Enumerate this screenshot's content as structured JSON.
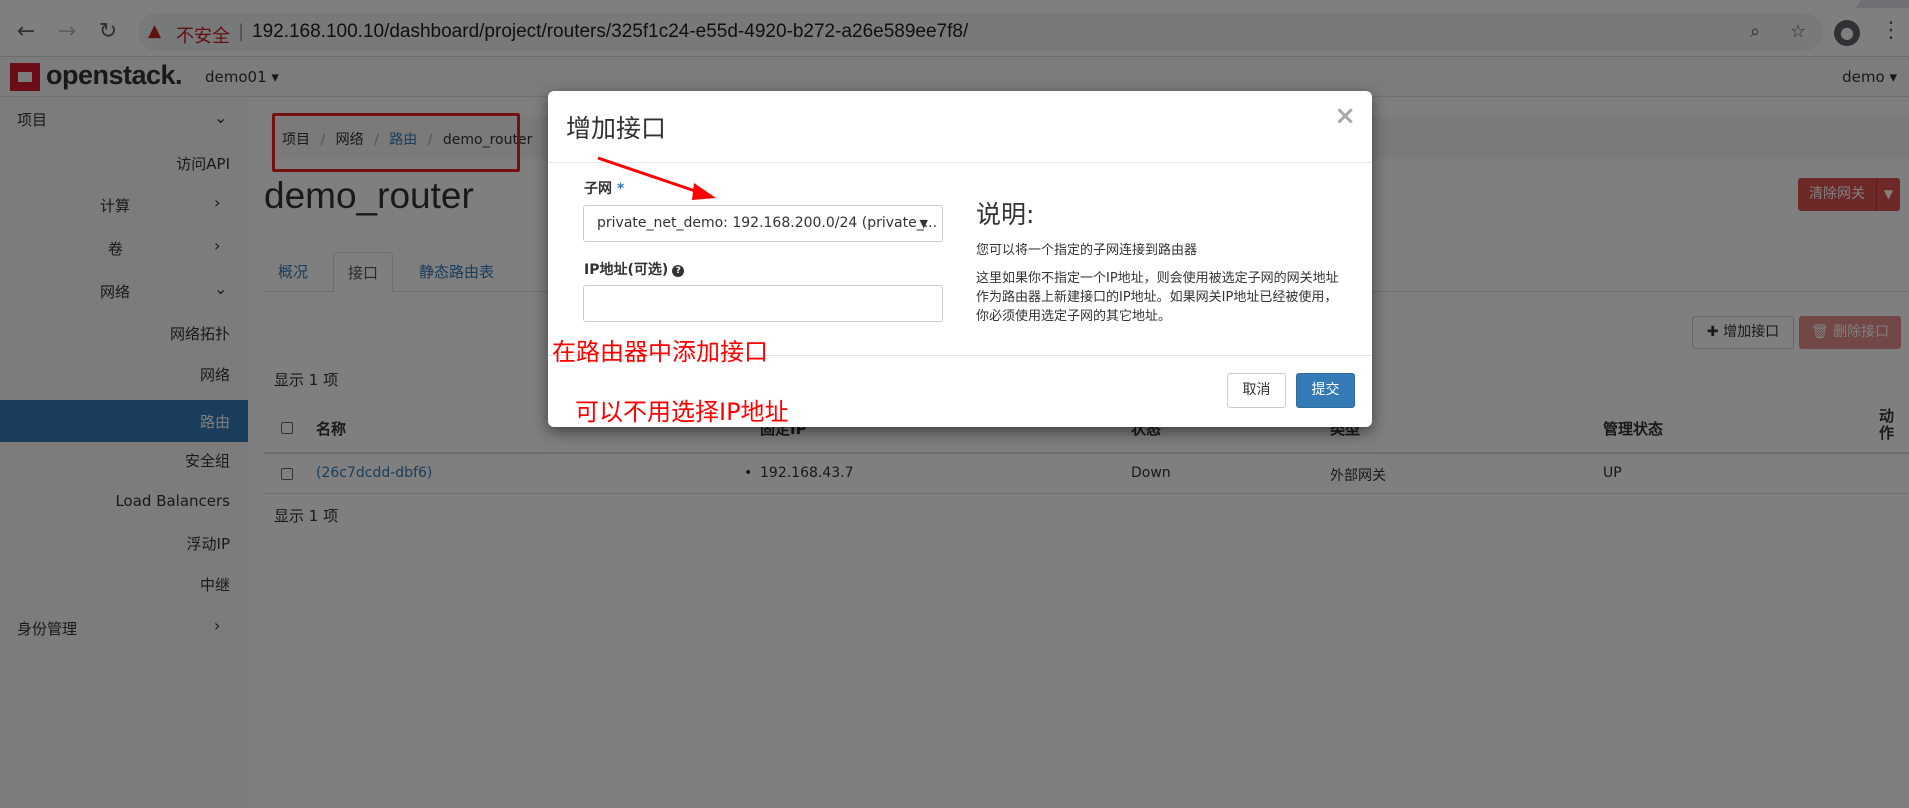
{
  "browser": {
    "insecure_label": "不安全",
    "separator": "|",
    "url": "192.168.100.10/dashboard/project/routers/325f1c24-e55d-4920-b272-a26e589ee7f8/"
  },
  "topnav": {
    "logo_text": "openstack.",
    "project": "demo01 ▾",
    "user": "demo ▾"
  },
  "sidebar": {
    "project": "项目",
    "access_api": "访问API",
    "compute": "计算",
    "volume": "卷",
    "network": "网络",
    "network_topology": "网络拓扑",
    "networks": "网络",
    "routers": "路由",
    "security_groups": "安全组",
    "load_balancers": "Load Balancers",
    "floating_ip": "浮动IP",
    "trunk": "中继",
    "identity": "身份管理"
  },
  "breadcrumb": {
    "project": "项目",
    "network": "网络",
    "routers": "路由",
    "current": "demo_router",
    "sep": "/"
  },
  "page": {
    "title": "demo_router",
    "clear_gateway": "清除网关",
    "tabs": [
      "概况",
      "接口",
      "静态路由表"
    ],
    "add_interface": "✚ 增加接口",
    "delete_interface": "🗑 删除接口",
    "count_label": "显示 1 项"
  },
  "table": {
    "headers": [
      "名称",
      "固定IP",
      "状态",
      "类型",
      "管理状态",
      "动作"
    ],
    "rows": [
      {
        "name": "(26c7dcdd-dbf6)",
        "fixed_ip": "192.168.43.7",
        "status": "Down",
        "type": "外部网关",
        "admin_state": "UP"
      }
    ]
  },
  "modal": {
    "title": "增加接口",
    "close": "×",
    "subnet_label": "子网",
    "required_mark": "*",
    "subnet_value": "private_net_demo: 192.168.200.0/24 (private_...",
    "ip_label": "IP地址(可选)",
    "desc_title": "说明:",
    "desc_p1": "您可以将一个指定的子网连接到路由器",
    "desc_p2": "这里如果你不指定一个IP地址，则会使用被选定子网的网关地址作为路由器上新建接口的IP地址。如果网关IP地址已经被使用，你必须使用选定子网的其它地址。",
    "cancel": "取消",
    "submit": "提交"
  },
  "annotations": {
    "add_interface_note": "在路由器中添加接口",
    "ip_note": "可以不用选择IP地址",
    "color": "#ff0000"
  }
}
